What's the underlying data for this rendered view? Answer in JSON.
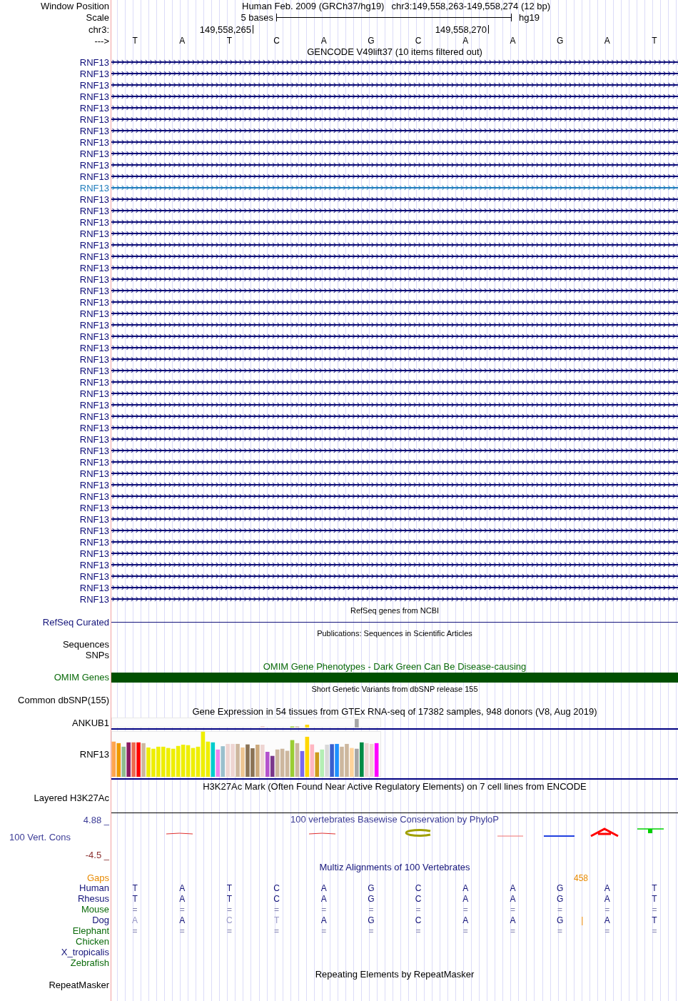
{
  "position": {
    "label": "Window Position",
    "assembly": "Human Feb. 2009 (GRCh37/hg19)",
    "range": "chr3:149,558,263-149,558,274 (12 bp)"
  },
  "scale": {
    "label": "Scale",
    "span": "5 bases",
    "db": "hg19"
  },
  "coordinates": {
    "label": "chr3:",
    "ticks": [
      "149,558,265",
      "149,558,270"
    ]
  },
  "strand": {
    "label": "--->",
    "bases": [
      "T",
      "A",
      "T",
      "C",
      "A",
      "G",
      "C",
      "A",
      "A",
      "G",
      "A",
      "T"
    ]
  },
  "gencode": {
    "title": "GENCODE V49lift37 (10 items filtered out)",
    "transcripts": [
      {
        "label": "RNF13",
        "color": "#0c0c78"
      },
      {
        "label": "RNF13",
        "color": "#0c0c78"
      },
      {
        "label": "RNF13",
        "color": "#0c0c78"
      },
      {
        "label": "RNF13",
        "color": "#0c0c78"
      },
      {
        "label": "RNF13",
        "color": "#0c0c78"
      },
      {
        "label": "RNF13",
        "color": "#0c0c78"
      },
      {
        "label": "RNF13",
        "color": "#0c0c78"
      },
      {
        "label": "RNF13",
        "color": "#0c0c78"
      },
      {
        "label": "RNF13",
        "color": "#0c0c78"
      },
      {
        "label": "RNF13",
        "color": "#0c0c78"
      },
      {
        "label": "RNF13",
        "color": "#0c0c78"
      },
      {
        "label": "RNF13",
        "color": "#1f7cbc"
      },
      {
        "label": "RNF13",
        "color": "#0c0c78"
      },
      {
        "label": "RNF13",
        "color": "#0c0c78"
      },
      {
        "label": "RNF13",
        "color": "#0c0c78"
      },
      {
        "label": "RNF13",
        "color": "#0c0c78"
      },
      {
        "label": "RNF13",
        "color": "#0c0c78"
      },
      {
        "label": "RNF13",
        "color": "#0c0c78"
      },
      {
        "label": "RNF13",
        "color": "#0c0c78"
      },
      {
        "label": "RNF13",
        "color": "#0c0c78"
      },
      {
        "label": "RNF13",
        "color": "#0c0c78"
      },
      {
        "label": "RNF13",
        "color": "#0c0c78"
      },
      {
        "label": "RNF13",
        "color": "#0c0c78"
      },
      {
        "label": "RNF13",
        "color": "#0c0c78"
      },
      {
        "label": "RNF13",
        "color": "#0c0c78"
      },
      {
        "label": "RNF13",
        "color": "#0c0c78"
      },
      {
        "label": "RNF13",
        "color": "#0c0c78"
      },
      {
        "label": "RNF13",
        "color": "#0c0c78"
      },
      {
        "label": "RNF13",
        "color": "#0c0c78"
      },
      {
        "label": "RNF13",
        "color": "#0c0c78"
      },
      {
        "label": "RNF13",
        "color": "#0c0c78"
      },
      {
        "label": "RNF13",
        "color": "#0c0c78"
      },
      {
        "label": "RNF13",
        "color": "#0c0c78"
      },
      {
        "label": "RNF13",
        "color": "#0c0c78"
      },
      {
        "label": "RNF13",
        "color": "#0c0c78"
      },
      {
        "label": "RNF13",
        "color": "#0c0c78"
      },
      {
        "label": "RNF13",
        "color": "#0c0c78"
      },
      {
        "label": "RNF13",
        "color": "#0c0c78"
      },
      {
        "label": "RNF13",
        "color": "#0c0c78"
      },
      {
        "label": "RNF13",
        "color": "#0c0c78"
      },
      {
        "label": "RNF13",
        "color": "#0c0c78"
      },
      {
        "label": "RNF13",
        "color": "#0c0c78"
      },
      {
        "label": "RNF13",
        "color": "#0c0c78"
      },
      {
        "label": "RNF13",
        "color": "#0c0c78"
      },
      {
        "label": "RNF13",
        "color": "#0c0c78"
      },
      {
        "label": "RNF13",
        "color": "#0c0c78"
      },
      {
        "label": "RNF13",
        "color": "#0c0c78"
      },
      {
        "label": "RNF13",
        "color": "#0c0c78"
      }
    ]
  },
  "refseq": {
    "title": "RefSeq genes from NCBI",
    "label": "RefSeq Curated"
  },
  "publications": {
    "title": "Publications: Sequences in Scientific Articles",
    "labels": [
      "Sequences",
      "SNPs"
    ]
  },
  "omim": {
    "title": "OMIM Gene Phenotypes - Dark Green Can Be Disease-causing",
    "label": "OMIM Genes"
  },
  "dbsnp": {
    "title": "Short Genetic Variants from dbSNP release 155",
    "label": "Common dbSNP(155)"
  },
  "gtex": {
    "title": "Gene Expression in 54 tissues from GTEx RNA-seq of 17382 samples, 948 donors (V8, Aug 2019)",
    "genes": [
      {
        "label": "ANKUB1",
        "kind": "low"
      },
      {
        "label": "RNF13",
        "kind": "high"
      }
    ]
  },
  "h3k27ac": {
    "title": "H3K27Ac Mark (Often Found Near Active Regulatory Elements) on 7 cell lines from ENCODE",
    "label": "Layered H3K27Ac"
  },
  "phylop": {
    "title": "100 vertebrates Basewise Conservation by PhyloP",
    "label": "100 Vert. Cons",
    "max": "4.88 _",
    "min": "-4.5 _"
  },
  "multiz": {
    "title": "Multiz Alignments of 100 Vertebrates",
    "gaps": {
      "label": "Gaps",
      "count": "458"
    },
    "species": [
      {
        "name": "Human",
        "color": "#14147a",
        "kind": "sequence",
        "bases": [
          {
            "text": "T",
            "mismatch": false
          },
          {
            "text": "A",
            "mismatch": false
          },
          {
            "text": "T",
            "mismatch": false
          },
          {
            "text": "C",
            "mismatch": false
          },
          {
            "text": "A",
            "mismatch": false
          },
          {
            "text": "G",
            "mismatch": false
          },
          {
            "text": "C",
            "mismatch": false
          },
          {
            "text": "A",
            "mismatch": false
          },
          {
            "text": "A",
            "mismatch": false
          },
          {
            "text": "G",
            "mismatch": false
          },
          {
            "text": "A",
            "mismatch": false
          },
          {
            "text": "T",
            "mismatch": false
          }
        ]
      },
      {
        "name": "Rhesus",
        "color": "#14147a",
        "kind": "sequence",
        "bases": [
          {
            "text": "T",
            "mismatch": false
          },
          {
            "text": "A",
            "mismatch": false
          },
          {
            "text": "T",
            "mismatch": false
          },
          {
            "text": "C",
            "mismatch": false
          },
          {
            "text": "A",
            "mismatch": false
          },
          {
            "text": "G",
            "mismatch": false
          },
          {
            "text": "C",
            "mismatch": false
          },
          {
            "text": "A",
            "mismatch": false
          },
          {
            "text": "A",
            "mismatch": false
          },
          {
            "text": "G",
            "mismatch": false
          },
          {
            "text": "A",
            "mismatch": false
          },
          {
            "text": "T",
            "mismatch": false
          }
        ]
      },
      {
        "name": "Mouse",
        "color": "#0b6b0b",
        "kind": "match",
        "bases": [
          {
            "text": "="
          },
          {
            "text": "="
          },
          {
            "text": "="
          },
          {
            "text": "="
          },
          {
            "text": "="
          },
          {
            "text": "="
          },
          {
            "text": "="
          },
          {
            "text": "="
          },
          {
            "text": "="
          },
          {
            "text": "="
          },
          {
            "text": "="
          },
          {
            "text": "="
          }
        ]
      },
      {
        "name": "Dog",
        "color": "#14147a",
        "kind": "sequence",
        "bases": [
          {
            "text": "A",
            "mismatch": true
          },
          {
            "text": "A",
            "mismatch": false
          },
          {
            "text": "C",
            "mismatch": true
          },
          {
            "text": "T",
            "mismatch": true
          },
          {
            "text": "A",
            "mismatch": false
          },
          {
            "text": "G",
            "mismatch": false
          },
          {
            "text": "C",
            "mismatch": false
          },
          {
            "text": "A",
            "mismatch": false
          },
          {
            "text": "A",
            "mismatch": false
          },
          {
            "text": "G",
            "mismatch": false,
            "insert_after": "|"
          },
          {
            "text": "A",
            "mismatch": false
          },
          {
            "text": "T",
            "mismatch": false
          }
        ]
      },
      {
        "name": "Elephant",
        "color": "#0b6b0b",
        "kind": "match",
        "bases": [
          {
            "text": "="
          },
          {
            "text": "="
          },
          {
            "text": "="
          },
          {
            "text": "="
          },
          {
            "text": "="
          },
          {
            "text": "="
          },
          {
            "text": "="
          },
          {
            "text": "="
          },
          {
            "text": "="
          },
          {
            "text": "="
          },
          {
            "text": "="
          },
          {
            "text": "="
          }
        ]
      },
      {
        "name": "Chicken",
        "color": "#0b6b0b",
        "kind": "none"
      },
      {
        "name": "X_tropicalis",
        "color": "#14147a",
        "kind": "none"
      },
      {
        "name": "Zebrafish",
        "color": "#0b6b0b",
        "kind": "none"
      }
    ]
  },
  "repeatmasker": {
    "title": "Repeating Elements by RepeatMasker",
    "label": "RepeatMasker"
  }
}
